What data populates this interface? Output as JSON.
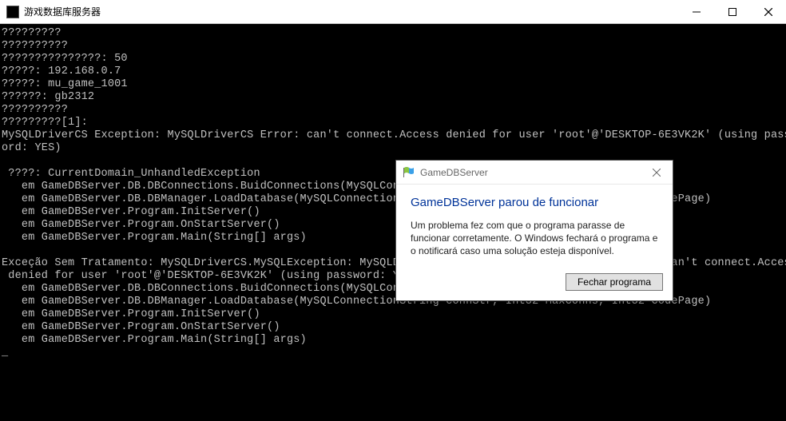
{
  "window": {
    "title": "游戏数据库服务器"
  },
  "console": {
    "lines": [
      "?????????",
      "??????????",
      "???????????????: 50",
      "?????: 192.168.0.7",
      "?????: mu_game_1001",
      "??????: gb2312",
      "??????????",
      "?????????[1]:",
      "MySQLDriverCS Exception: MySQLDriverCS Error: can't connect.Access denied for user 'root'@'DESKTOP-6E3VK2K' (using passw",
      "ord: YES)",
      "",
      " ????: CurrentDomain_UnhandledException",
      "   em GameDBServer.DB.DBConnections.BuidConnections(MySQLConnectionString connStr, Int32 maxCount)",
      "   em GameDBServer.DB.DBManager.LoadDatabase(MySQLConnectionString connStr, Int32 MaxConns, Int32 CodePage)",
      "   em GameDBServer.Program.InitServer()",
      "   em GameDBServer.Program.OnStartServer()",
      "   em GameDBServer.Program.Main(String[] args)",
      "",
      "Exceção Sem Tratamento: MySQLDriverCS.MySQLException: MySQLDriverCS Exception: MySQLDriverCS Error: can't connect.Access",
      " denied for user 'root'@'DESKTOP-6E3VK2K' (using password: YES)",
      "   em GameDBServer.DB.DBConnections.BuidConnections(MySQLConnectionString connStr, Int32 maxCount)",
      "   em GameDBServer.DB.DBManager.LoadDatabase(MySQLConnectionString connStr, Int32 MaxConns, Int32 CodePage)",
      "   em GameDBServer.Program.InitServer()",
      "   em GameDBServer.Program.OnStartServer()",
      "   em GameDBServer.Program.Main(String[] args)",
      "_"
    ]
  },
  "dialog": {
    "title": "GameDBServer",
    "heading": "GameDBServer parou de funcionar",
    "body": "Um problema fez com que o programa parasse de funcionar corretamente. O Windows fechará o programa e o notificará caso uma solução esteja disponível.",
    "button": "Fechar programa"
  }
}
